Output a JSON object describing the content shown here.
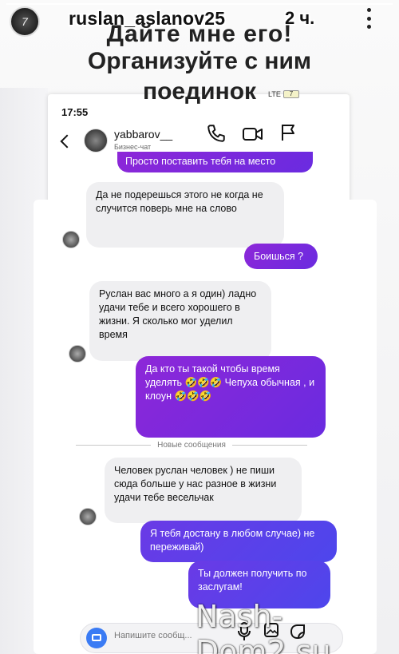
{
  "story": {
    "username": "ruslan_aslanov25",
    "time_ago": "2 ч.",
    "caption_line1": "Дайте мне его!",
    "caption_line2": "Организуйте с ним",
    "caption_line3": "поединок"
  },
  "phone": {
    "status_time": "17:55",
    "network": "LTE",
    "battery": "7"
  },
  "chat": {
    "name": "yabbarov__",
    "subtitle": "Бизнес-чат",
    "new_messages_label": "Новые сообщения",
    "composer_placeholder": "Напишите сообщ..."
  },
  "messages": [
    {
      "side": "out",
      "text": "Просто поставить тебя на место"
    },
    {
      "side": "in",
      "text": "Да не подерешься этого не когда не случится поверь мне на слово"
    },
    {
      "side": "out",
      "text": "Боишься ?"
    },
    {
      "side": "in",
      "text": "Руслан вас много а я один) ладно удачи тебе и всего хорошего в жизни. Я сколько мог уделил время"
    },
    {
      "side": "out",
      "text": "Да кто ты такой чтобы время уделять 🤣🤣🤣 Чепуха обычная , и клоун 🤣🤣🤣"
    },
    {
      "side": "in",
      "text": "Человек руслан человек ) не пиши сюда больше у нас разное в жизни удачи тебе весельчак"
    },
    {
      "side": "out",
      "text": "Я тебя достану в любом случае) не переживай)"
    },
    {
      "side": "out",
      "text": "Ты должен получить по заслугам!"
    }
  ],
  "watermark": "Nash-Dom2.su",
  "icons": {
    "back": "chevron-left-icon",
    "phone": "phone-icon",
    "video": "video-camera-icon",
    "flag": "flag-icon",
    "camera": "camera-icon",
    "mic": "microphone-icon",
    "gallery": "gallery-icon",
    "sticker": "sticker-icon",
    "more": "more-vertical-icon"
  },
  "colors": {
    "bubble_out": "#8d27d8",
    "bubble_out_blue": "#4d46ec",
    "bubble_in": "#efeff1",
    "camera_button": "#3a7bf4"
  }
}
